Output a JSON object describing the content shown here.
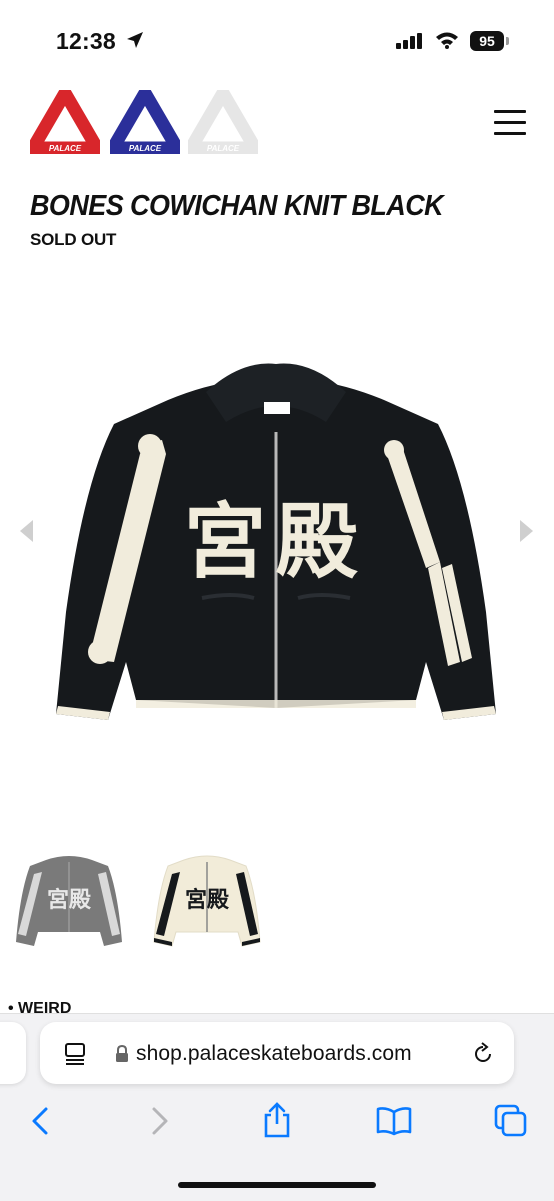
{
  "status_bar": {
    "time": "12:38",
    "battery": "95"
  },
  "header": {
    "logos": [
      {
        "name": "palace-logo-red",
        "text": "PALACE",
        "color": "#d8262b"
      },
      {
        "name": "palace-logo-blue",
        "text": "PALACE",
        "color": "#2b2f9a"
      },
      {
        "name": "palace-logo-white",
        "text": "PALACE",
        "color": "#e6e6e6"
      }
    ],
    "menu_icon": "hamburger-icon"
  },
  "product": {
    "title": "BONES COWICHAN KNIT BLACK",
    "status": "SOLD OUT",
    "image_glyphs": "宮殿",
    "thumbnails": [
      {
        "name": "grey-knit",
        "glyphs": "宮殿",
        "color": "#7a7a7a"
      },
      {
        "name": "cream-knit",
        "glyphs": "宮殿",
        "color": "#f2ecd9"
      }
    ]
  },
  "details": {
    "first_item": "WEIRD"
  },
  "browser": {
    "url": "shop.palaceskateboards.com",
    "icons": [
      "reader-icon",
      "lock-icon",
      "reload-icon",
      "back-icon",
      "forward-icon",
      "share-icon",
      "bookmarks-icon",
      "tabs-icon"
    ]
  },
  "colors": {
    "accent_blue": "#0a7aff",
    "knit_black": "#16191c",
    "cream": "#f1ecdc"
  }
}
